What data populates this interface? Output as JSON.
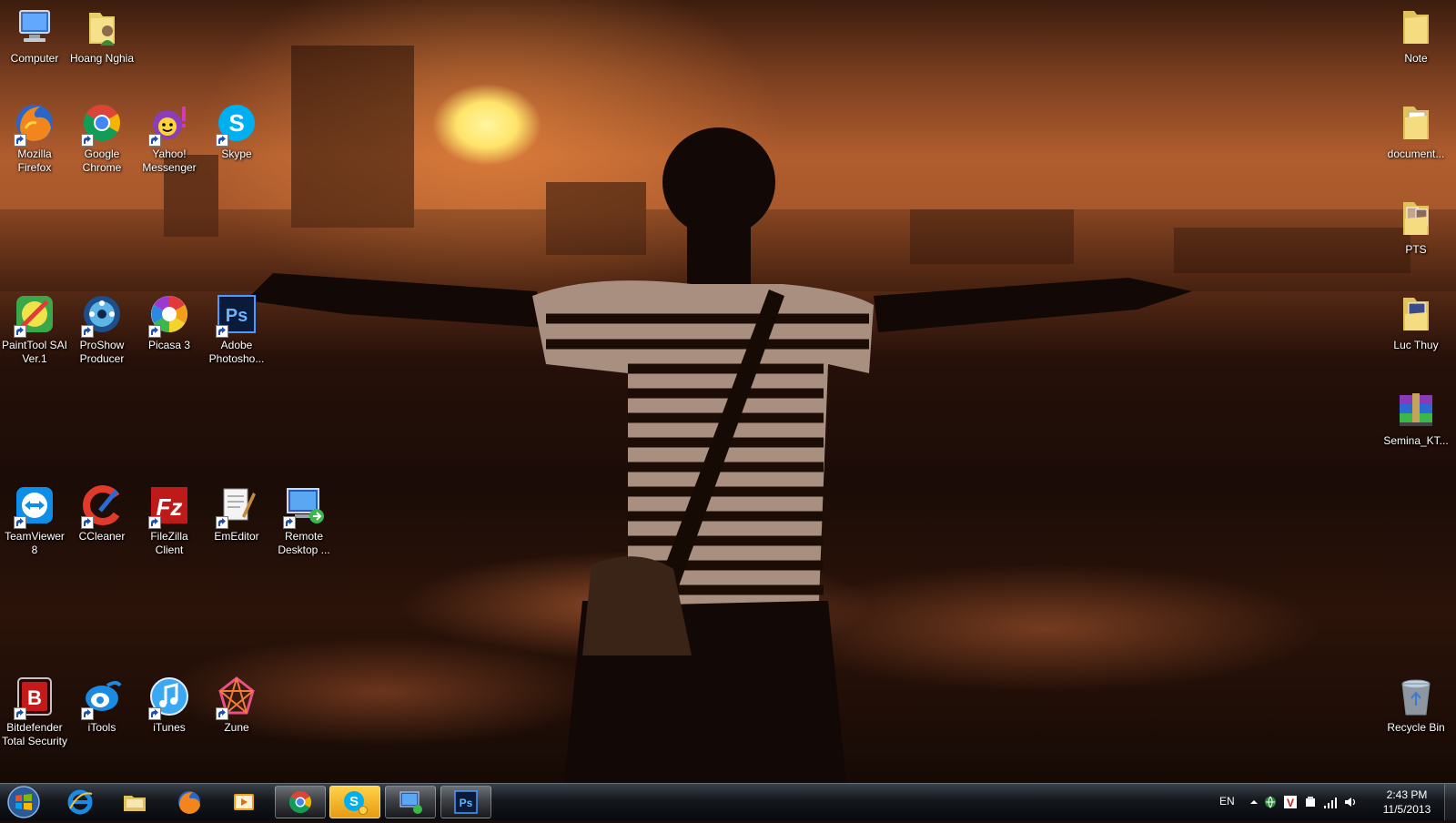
{
  "desktop_icons": {
    "computer": "Computer",
    "hoang_nghia": "Hoang Nghia",
    "firefox": "Mozilla\nFirefox",
    "chrome": "Google\nChrome",
    "yahoo": "Yahoo!\nMessenger",
    "skype": "Skype",
    "painttool": "PaintTool SAI\nVer.1",
    "proshow": "ProShow\nProducer",
    "picasa": "Picasa 3",
    "photoshop": "Adobe\nPhotosho...",
    "teamviewer": "TeamViewer\n8",
    "ccleaner": "CCleaner",
    "filezilla": "FileZilla\nClient",
    "emeditor": "EmEditor",
    "remote_desktop": "Remote\nDesktop ...",
    "bitdefender": "Bitdefender\nTotal Security",
    "itools": "iTools",
    "itunes": "iTunes",
    "zune": "Zune",
    "note": "Note",
    "documents": "document...",
    "pts": "PTS",
    "luc_thuy": "Luc Thuy",
    "semina": "Semina_KT...",
    "recycle_bin": "Recycle Bin"
  },
  "taskbar": {
    "pinned": [
      "start-orb",
      "internet-explorer-icon",
      "windows-explorer-icon",
      "firefox-icon",
      "media-player-icon",
      "chrome-icon",
      "skype-icon",
      "remote-desktop-icon",
      "photoshop-icon"
    ],
    "active_app": "skype"
  },
  "tray": {
    "language": "EN",
    "time": "2:43 PM",
    "date": "11/5/2013"
  },
  "colors": {
    "skype_blue": "#00aff0",
    "taskbar_active": "#f0a820",
    "sunset_orange": "#b05d2e"
  }
}
